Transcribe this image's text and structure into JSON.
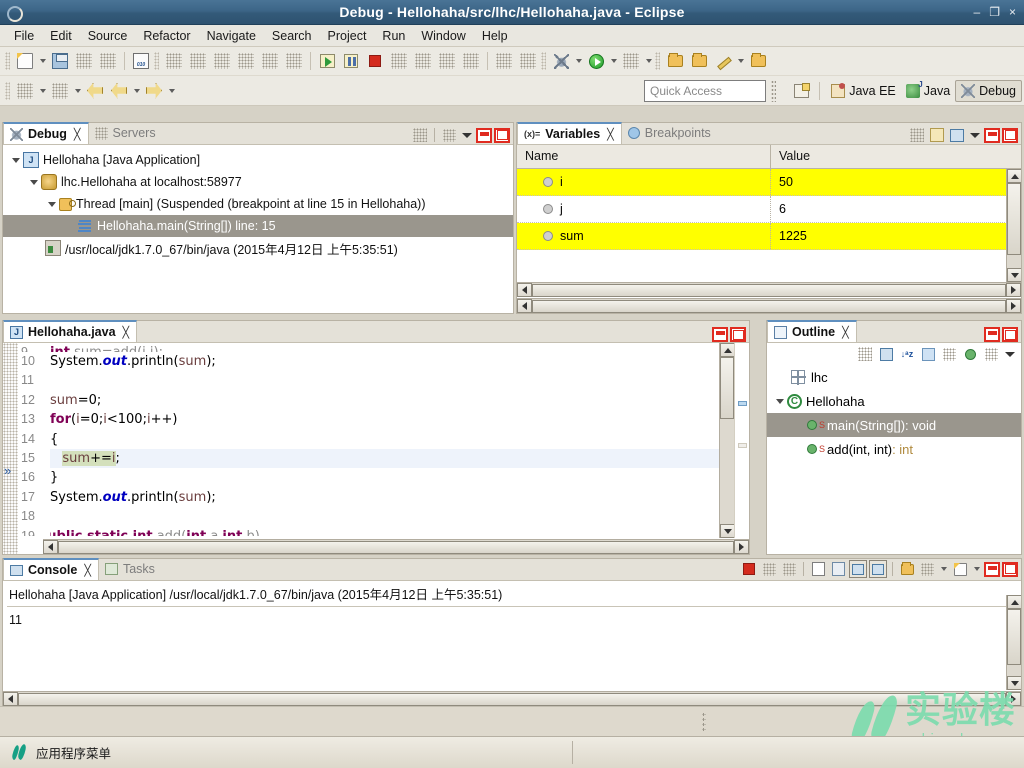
{
  "window": {
    "title": "Debug - Hellohaha/src/lhc/Hellohaha.java - Eclipse",
    "minimize": "–",
    "restore": "❐",
    "close": "×"
  },
  "menubar": {
    "items": [
      {
        "label": "File",
        "mnemonic": "F"
      },
      {
        "label": "Edit",
        "mnemonic": "E"
      },
      {
        "label": "Source",
        "mnemonic": "S"
      },
      {
        "label": "Refactor",
        "mnemonic": "t"
      },
      {
        "label": "Navigate",
        "mnemonic": "N"
      },
      {
        "label": "Search",
        "mnemonic": "a"
      },
      {
        "label": "Project",
        "mnemonic": "P"
      },
      {
        "label": "Run",
        "mnemonic": "R"
      },
      {
        "label": "Window",
        "mnemonic": "W"
      },
      {
        "label": "Help",
        "mnemonic": "H"
      }
    ]
  },
  "toolbar": {
    "quick_access_placeholder": "Quick Access",
    "perspectives": [
      {
        "label": "Java EE",
        "active": false
      },
      {
        "label": "Java",
        "active": false
      },
      {
        "label": "Debug",
        "active": true
      }
    ],
    "icons_row1": [
      "new-wizard-icon",
      "new-dropdown-icon",
      "save-icon",
      "print-icon",
      "gray-tool-icon",
      "binary-010-icon",
      "annotate-icon",
      "yellow-tool-icon",
      "gray-block-icon",
      "table-grid-icon",
      "table-col-icon",
      "pen-strike-icon",
      "resume-icon",
      "pause-icon",
      "terminate-icon",
      "disconnect-icon",
      "step-into-icon",
      "step-over-icon",
      "step-return-icon",
      "grid-icon",
      "search-type-icon",
      "debug-as-icon",
      "debug-dropdown-icon",
      "run-as-icon",
      "run-dropdown-icon",
      "external-tools-icon",
      "external-dropdown-icon",
      "open-folder-icon",
      "open-type-icon",
      "highlight-icon",
      "highlight-dropdown-icon",
      "open-task-icon"
    ],
    "icons_row2": [
      "gray-icon",
      "gray-dropdown-icon",
      "gray-icon-2",
      "gray-dropdown-icon-2",
      "back-with-star-icon",
      "back-icon",
      "back-dropdown-icon",
      "forward-icon",
      "forward-dropdown-icon"
    ]
  },
  "debug_view": {
    "tabs": [
      {
        "label": "Debug",
        "active": true,
        "icon": "debug-icon",
        "closable": true
      },
      {
        "label": "Servers",
        "active": false,
        "icon": "servers-icon",
        "closable": false
      }
    ],
    "tools": [
      "threads-icon",
      "view-menu-icon",
      "chevron-down-icon",
      "minimize-icon",
      "maximize-icon"
    ],
    "tree": [
      {
        "depth": 0,
        "twisty": true,
        "icon": "java-app-icon",
        "label": "Hellohaha [Java Application]",
        "selected": false
      },
      {
        "depth": 1,
        "twisty": true,
        "icon": "vm-icon",
        "label": "lhc.Hellohaha at localhost:58977",
        "selected": false
      },
      {
        "depth": 2,
        "twisty": true,
        "icon": "thread-icon",
        "label": "Thread [main] (Suspended (breakpoint at line 15 in Hellohaha))",
        "selected": false
      },
      {
        "depth": 3,
        "twisty": false,
        "icon": "stack-frame-icon",
        "label": "Hellohaha.main(String[]) line: 15",
        "selected": true
      },
      {
        "depth": 2,
        "twisty": false,
        "icon": "process-icon",
        "label": "/usr/local/jdk1.7.0_67/bin/java (2015年4月12日 上午5:35:51)",
        "selected": false
      }
    ]
  },
  "variables_view": {
    "tabs": [
      {
        "label": "Variables",
        "active": true,
        "icon": "variables-icon",
        "closable": true
      },
      {
        "label": "Breakpoints",
        "active": false,
        "icon": "breakpoints-icon",
        "closable": false
      }
    ],
    "tools": [
      "collapse-icon",
      "sort-icon",
      "layout-icon",
      "chevron-down-icon",
      "minimize-icon",
      "maximize-icon"
    ],
    "columns": [
      "Name",
      "Value"
    ],
    "rows": [
      {
        "name": "i",
        "value": "50",
        "highlight": true
      },
      {
        "name": "j",
        "value": "6",
        "highlight": false
      },
      {
        "name": "sum",
        "value": "1225",
        "highlight": true
      }
    ],
    "highlight_color": "#ffff00"
  },
  "editor": {
    "tab": {
      "label": "Hellohaha.java",
      "icon": "java-file-icon",
      "closable": true,
      "active": true
    },
    "current_line": 15,
    "lines": [
      {
        "num": "9",
        "partial_top": true,
        "html": "        int sum=add(i,j);"
      },
      {
        "num": "10",
        "html": "        System.out.println(sum);"
      },
      {
        "num": "11",
        "html": ""
      },
      {
        "num": "12",
        "html": "        sum=0;"
      },
      {
        "num": "13",
        "html": "        for(i=0;i<100;i++)"
      },
      {
        "num": "14",
        "html": "        {"
      },
      {
        "num": "15",
        "html": "            sum+=i;"
      },
      {
        "num": "16",
        "html": "        }"
      },
      {
        "num": "17",
        "html": "        System.out.println(sum);"
      },
      {
        "num": "18",
        "html": "    }"
      },
      {
        "num": "19",
        "partial_bottom": true,
        "html": "    public static int add(int a,int b)"
      }
    ]
  },
  "outline_view": {
    "tab": {
      "label": "Outline",
      "icon": "outline-icon",
      "closable": true
    },
    "tools": [
      "gray-icon",
      "collapse-all-icon",
      "sort-az-icon",
      "hide-fields-icon",
      "hide-static-icon",
      "hide-nonpublic-icon",
      "hide-local-icon",
      "chevron-down-icon"
    ],
    "window_buttons": [
      "minimize-icon",
      "maximize-icon"
    ],
    "items": [
      {
        "depth": 0,
        "twisty": false,
        "icon": "package-icon",
        "label": "lhc",
        "rettype": "",
        "static": false,
        "selected": false
      },
      {
        "depth": 0,
        "twisty": true,
        "icon": "class-icon",
        "label": "Hellohaha",
        "rettype": "",
        "static": false,
        "selected": false
      },
      {
        "depth": 1,
        "twisty": false,
        "icon": "method-icon",
        "label": "main(String[])",
        "rettype": " : void",
        "static": true,
        "selected": true
      },
      {
        "depth": 1,
        "twisty": false,
        "icon": "method-icon",
        "label": "add(int, int)",
        "rettype": " : int",
        "static": true,
        "selected": false
      }
    ]
  },
  "console_view": {
    "tabs": [
      {
        "label": "Console",
        "active": true,
        "icon": "console-icon",
        "closable": true
      },
      {
        "label": "Tasks",
        "active": false,
        "icon": "tasks-icon",
        "closable": false
      }
    ],
    "tools": [
      "terminate-icon",
      "remove-launch-icon",
      "remove-all-icon",
      "clear-console-icon",
      "scroll-lock-icon",
      "pin-console-icon",
      "display-console-icon",
      "open-console-icon",
      "new-console-icon",
      "new-console-dropdown-icon",
      "open-dropdown-icon",
      "minimize-icon",
      "maximize-icon"
    ],
    "header": "Hellohaha [Java Application] /usr/local/jdk1.7.0_67/bin/java (2015年4月12日 上午5:35:51)",
    "output": "11"
  },
  "taskbar": {
    "item_label": "应用程序菜单",
    "icon": "shiyanlou-leaf-icon"
  },
  "watermark": {
    "cn": "实验楼",
    "en": "shiyanlou.com",
    "color": "#7ddcae"
  }
}
